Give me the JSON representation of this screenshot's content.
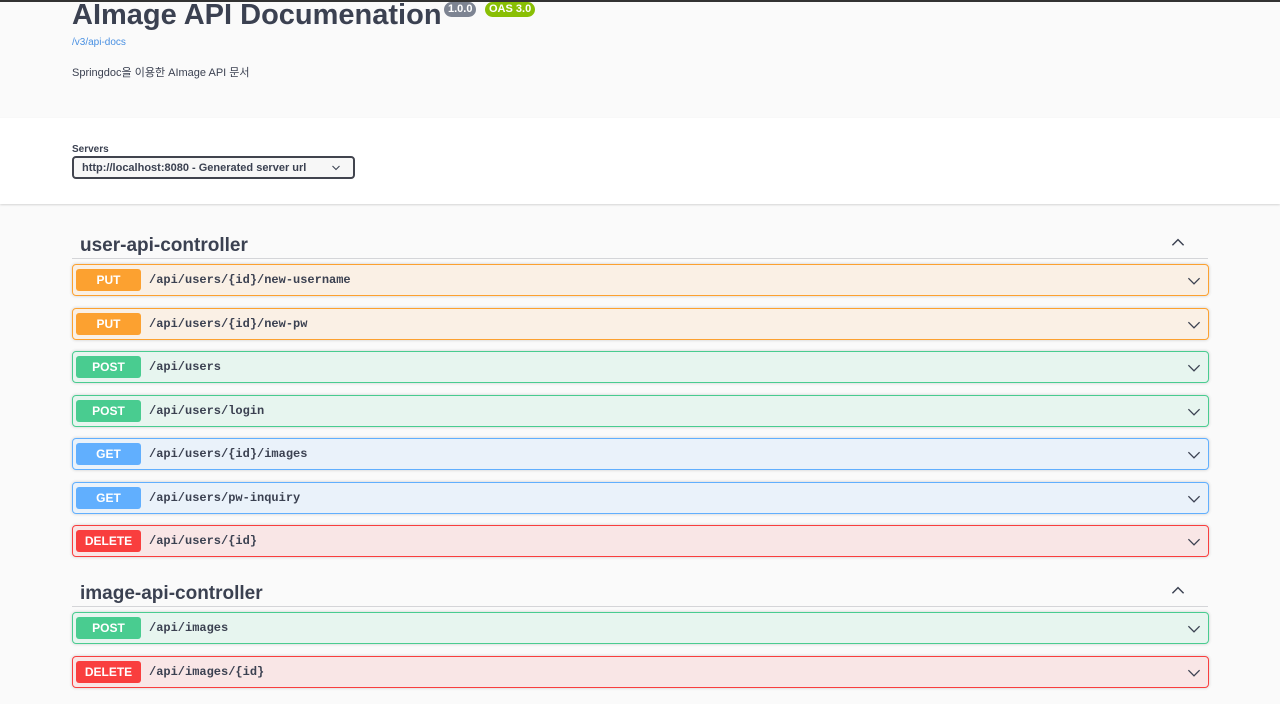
{
  "info": {
    "title": "AImage API Documenation",
    "version_badge": "1.0.0",
    "oas_badge": "OAS 3.0",
    "spec_link": "/v3/api-docs",
    "description": "Springdoc을 이용한 AImage API 문서"
  },
  "servers": {
    "label": "Servers",
    "selected": "http://localhost:8080 - Generated server url"
  },
  "tags": [
    {
      "name": "user-api-controller",
      "expanded": true,
      "operations": [
        {
          "method": "PUT",
          "path": "/api/users/{id}/new-username"
        },
        {
          "method": "PUT",
          "path": "/api/users/{id}/new-pw"
        },
        {
          "method": "POST",
          "path": "/api/users"
        },
        {
          "method": "POST",
          "path": "/api/users/login"
        },
        {
          "method": "GET",
          "path": "/api/users/{id}/images"
        },
        {
          "method": "GET",
          "path": "/api/users/pw-inquiry"
        },
        {
          "method": "DELETE",
          "path": "/api/users/{id}"
        }
      ]
    },
    {
      "name": "image-api-controller",
      "expanded": true,
      "operations": [
        {
          "method": "POST",
          "path": "/api/images"
        },
        {
          "method": "DELETE",
          "path": "/api/images/{id}"
        }
      ]
    }
  ],
  "colors": {
    "put": "#fca130",
    "post": "#49cc90",
    "get": "#61afe4",
    "delete": "#f93e3e"
  },
  "icons": {
    "tag_toggle": "chevron-up-icon",
    "operation_toggle": "chevron-down-icon",
    "server_select": "chevron-down-icon"
  }
}
